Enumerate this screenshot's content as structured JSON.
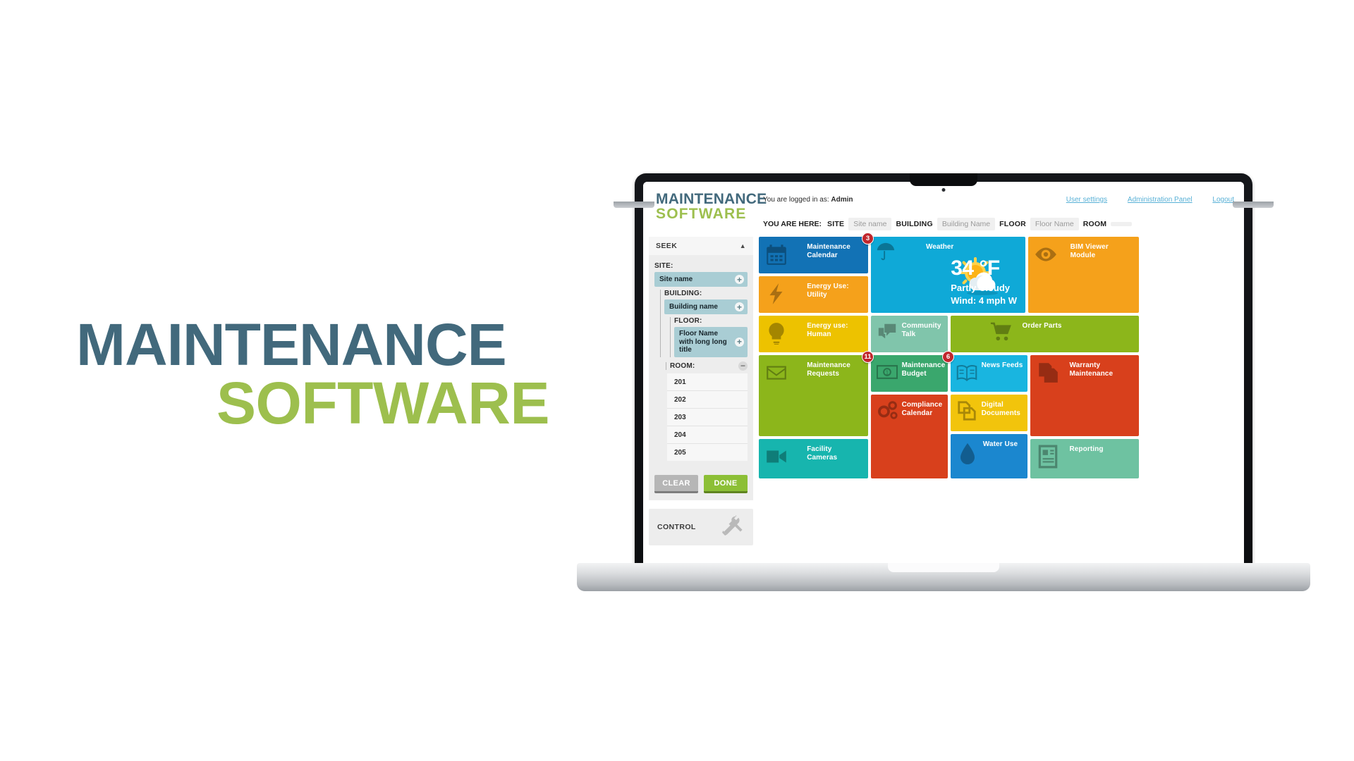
{
  "hero": {
    "line1": "MAINTENANCE",
    "line2": "SOFTWARE"
  },
  "brand": {
    "line1": "MAINTENANCE",
    "line2": "SOFTWARE",
    "color_blue": "#42697C",
    "color_green": "#9DBF4E"
  },
  "topbar": {
    "logged_in_prefix": "You are logged in as:",
    "logged_in_user": "Admin",
    "links": [
      {
        "label": "User settings"
      },
      {
        "label": "Administration Panel"
      },
      {
        "label": "Logout"
      }
    ]
  },
  "breadcrumb": {
    "prefix": "YOU ARE HERE:",
    "items": [
      {
        "key": "SITE",
        "value": "Site name"
      },
      {
        "key": "BUILDING",
        "value": "Building Name"
      },
      {
        "key": "FLOOR",
        "value": "Floor Name"
      },
      {
        "key": "ROOM",
        "value": ""
      }
    ]
  },
  "sidebar": {
    "seek": {
      "title": "SEEK",
      "collapse_icon": "caret-up-icon",
      "site_label": "SITE:",
      "site_value": "Site name",
      "building_label": "BUILDING:",
      "building_value": "Building name",
      "floor_label": "FLOOR:",
      "floor_value": "Floor Name with long long title",
      "room_label": "ROOM:",
      "rooms": [
        "201",
        "202",
        "203",
        "204",
        "205"
      ],
      "clear_label": "CLEAR",
      "done_label": "DONE"
    },
    "control": {
      "title": "CONTROL",
      "icon": "tools-icon"
    }
  },
  "tiles": [
    {
      "id": "maintenance-calendar",
      "label": "Maintenance Calendar",
      "color": "#1272b5",
      "icon": "calendar-icon",
      "badge": "3"
    },
    {
      "id": "energy-use-utility",
      "label": "Energy Use: Utility",
      "color": "#f5a11b",
      "icon": "bolt-icon",
      "badge": ""
    },
    {
      "id": "energy-use-human",
      "label": "Energy use: Human",
      "color": "#edc200",
      "icon": "bulb-icon",
      "badge": ""
    },
    {
      "id": "maintenance-requests",
      "label": "Maintenance Requests",
      "color": "#8cb61b",
      "icon": "envelope-icon",
      "badge": "11"
    },
    {
      "id": "facility-cameras",
      "label": "Facility Cameras",
      "color": "#17b5ae",
      "icon": "camera-icon",
      "badge": ""
    },
    {
      "id": "weather",
      "label": "Weather",
      "color": "#0fa9d7",
      "icon": "umbrella-icon",
      "badge": ""
    },
    {
      "id": "bim-viewer-module",
      "label": "BIM Viewer Module",
      "color": "#f5a11b",
      "icon": "eye-icon",
      "badge": ""
    },
    {
      "id": "community-talk",
      "label": "Community Talk",
      "color": "#80c5ab",
      "icon": "chat-icon",
      "badge": ""
    },
    {
      "id": "order-parts",
      "label": "Order Parts",
      "color": "#8cb61b",
      "icon": "cart-icon",
      "badge": ""
    },
    {
      "id": "maintenance-budget",
      "label": "Maintenance Budget",
      "color": "#3aa76d",
      "icon": "banknote-icon",
      "badge": "6"
    },
    {
      "id": "news-feeds",
      "label": "News Feeds",
      "color": "#19b5e0",
      "icon": "book-icon",
      "badge": ""
    },
    {
      "id": "warranty-maintenance",
      "label": "Warranty Maintenance",
      "color": "#d8401c",
      "icon": "documents-icon",
      "badge": ""
    },
    {
      "id": "compliance-calendar",
      "label": "Compliance Calendar",
      "color": "#d8401c",
      "icon": "gears-icon",
      "badge": ""
    },
    {
      "id": "digital-documents",
      "label": "Digital Documents",
      "color": "#f2c40c",
      "icon": "files-icon",
      "badge": ""
    },
    {
      "id": "water-use",
      "label": "Water Use",
      "color": "#1b87cf",
      "icon": "droplet-icon",
      "badge": ""
    },
    {
      "id": "reporting",
      "label": "Reporting",
      "color": "#6ec2a1",
      "icon": "report-icon",
      "badge": ""
    }
  ],
  "weather": {
    "title": "Weather",
    "temperature": "34 °F",
    "condition": "Partly Cloudy",
    "wind": "Wind: 4 mph W",
    "icon": "sun-behind-cloud-icon"
  }
}
